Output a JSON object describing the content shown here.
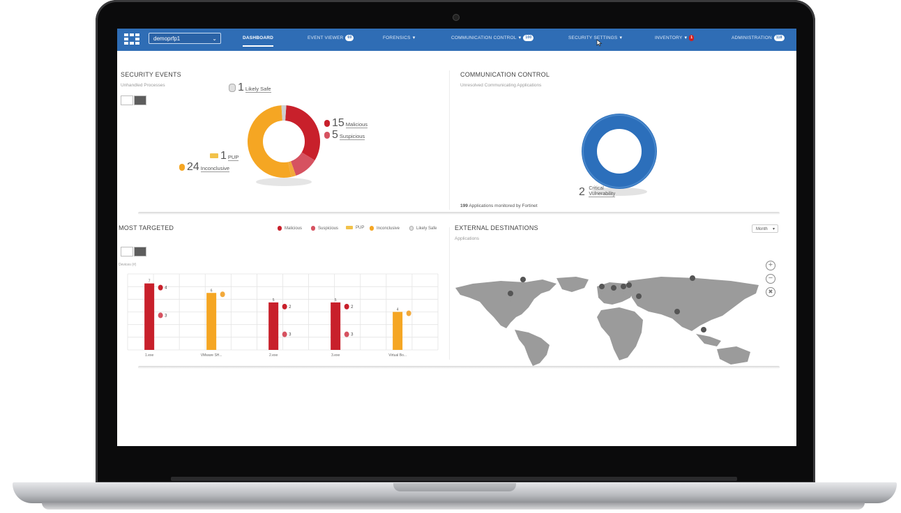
{
  "header": {
    "org_select": "demoprfp1",
    "nav": [
      {
        "label": "DASHBOARD"
      },
      {
        "label": "EVENT VIEWER",
        "badge": "69"
      },
      {
        "label": "FORENSICS"
      },
      {
        "label": "COMMUNICATION CONTROL",
        "badge": "100"
      },
      {
        "label": "SECURITY SETTINGS"
      },
      {
        "label": "INVENTORY",
        "badge": "1"
      },
      {
        "label": "ADMINISTRATION",
        "badge": "118"
      }
    ]
  },
  "security_events": {
    "title": "SECURITY EVENTS",
    "subtitle": "Unhandled Processes",
    "likely_safe": {
      "count": "1",
      "label": "Likely Safe"
    },
    "malicious": {
      "count": "15",
      "label": "Malicious"
    },
    "suspicious": {
      "count": "5",
      "label": "Suspicious"
    },
    "pup": {
      "count": "1",
      "label": "PUP"
    },
    "inconclusive": {
      "count": "24",
      "label": "Inconclusive"
    }
  },
  "communication_control": {
    "title": "COMMUNICATION CONTROL",
    "subtitle": "Unresolved Communicating Applications",
    "critical": {
      "count": "2",
      "label_line1": "Critical",
      "label_line2": "Vulnerability"
    },
    "monitored_count": "199",
    "monitored_text": "Applications monitored by Fortinet"
  },
  "most_targeted": {
    "title": "MOST TARGETED",
    "subtitle": "Devices (#)",
    "legend": [
      "Malicious",
      "Suspicious",
      "PUP",
      "Inconclusive",
      "Likely Safe"
    ]
  },
  "external_destinations": {
    "title": "EXTERNAL DESTINATIONS",
    "subtitle": "Applications",
    "range_select": "Month"
  },
  "colors": {
    "header_blue": "#2f6db5",
    "malicious": "#c8202b",
    "suspicious": "#d65260",
    "pup": "#f2a93b",
    "inconclusive": "#f5a623",
    "likely_safe": "#cfcfcf",
    "comm_blue": "#2c6fbb"
  },
  "icons": [
    "menu-grid-icon",
    "chevron-down-icon",
    "monitor-icon",
    "grid-icon",
    "shield-icon",
    "zoom-in-icon",
    "zoom-out-icon",
    "reset-icon",
    "map-pin-icon",
    "cursor-icon"
  ],
  "chart_data": [
    {
      "type": "pie",
      "labels": [
        "Malicious",
        "Suspicious",
        "PUP",
        "Inconclusive",
        "Likely Safe"
      ],
      "values": [
        15,
        5,
        1,
        24,
        1
      ]
    },
    {
      "type": "pie",
      "labels": [
        "Critical Vulnerability"
      ],
      "values": [
        2
      ]
    },
    {
      "type": "bar",
      "categories": [
        "1.exe",
        "VMware SH...",
        "2.exe",
        "3.exe",
        "Virtual Bo..."
      ],
      "series": [
        {
          "name": "Malicious",
          "values": [
            7,
            0,
            5,
            5,
            0
          ]
        },
        {
          "name": "Suspicious",
          "values": [
            4,
            0,
            2,
            2,
            0
          ]
        },
        {
          "name": "Suspicious",
          "values": [
            3,
            0,
            3,
            3,
            0
          ]
        },
        {
          "name": "Inconclusive",
          "values": [
            0,
            6,
            0,
            0,
            4
          ]
        }
      ]
    }
  ]
}
